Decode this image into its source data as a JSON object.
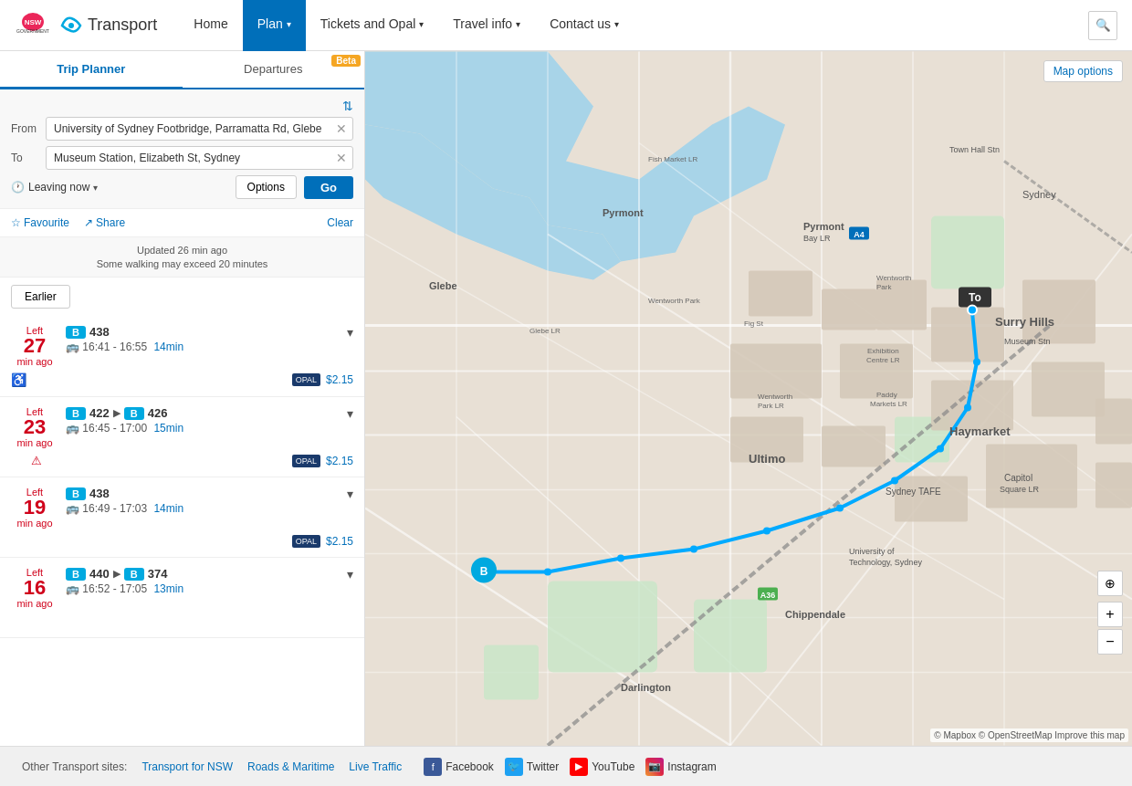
{
  "header": {
    "home_label": "Home",
    "plan_label": "Plan",
    "tickets_label": "Tickets and Opal",
    "travel_label": "Travel info",
    "contact_label": "Contact us",
    "logo_alt": "NSW Transport",
    "logo_transport": "Transport"
  },
  "tabs": {
    "trip_planner": "Trip Planner",
    "departures": "Departures",
    "beta": "Beta"
  },
  "form": {
    "from_label": "From",
    "from_value": "University of Sydney Footbridge, Parramatta Rd, Glebe",
    "to_label": "To",
    "to_value": "Museum Station, Elizabeth St, Sydney",
    "leaving_now": "Leaving now",
    "options_label": "Options",
    "go_label": "Go"
  },
  "actions": {
    "favourite": "Favourite",
    "share": "Share",
    "clear": "Clear"
  },
  "info": {
    "updated": "Updated 26 min ago",
    "walking_note": "Some walking may exceed 20 minutes"
  },
  "earlier_btn": "Earlier",
  "trips": [
    {
      "left_label": "Left",
      "minutes": "27",
      "ago": "min ago",
      "bus_badge": "B",
      "route": "438",
      "time_range": "16:41 - 16:55",
      "duration": "14min",
      "has_accessibility": true,
      "has_warning": false,
      "price": "$2.15"
    },
    {
      "left_label": "Left",
      "minutes": "23",
      "ago": "min ago",
      "bus_badge": "B",
      "route": "422",
      "route2_badge": "B",
      "route2": "426",
      "time_range": "16:45 - 17:00",
      "duration": "15min",
      "has_accessibility": false,
      "has_warning": true,
      "price": "$2.15"
    },
    {
      "left_label": "Left",
      "minutes": "19",
      "ago": "min ago",
      "bus_badge": "B",
      "route": "438",
      "time_range": "16:49 - 17:03",
      "duration": "14min",
      "has_accessibility": false,
      "has_warning": false,
      "price": "$2.15"
    },
    {
      "left_label": "Left",
      "minutes": "16",
      "ago": "min ago",
      "bus_badge": "B",
      "route": "440",
      "route2_badge": "B",
      "route2": "374",
      "time_range": "16:52 - 17:05",
      "duration": "13min",
      "has_accessibility": false,
      "has_warning": false,
      "price": null
    }
  ],
  "map": {
    "options_label": "Map options",
    "attribution": "© Mapbox © OpenStreetMap  Improve this map"
  },
  "footer": {
    "other_sites_label": "Other Transport sites:",
    "transport_nsw": "Transport for NSW",
    "roads": "Roads & Maritime",
    "live_traffic": "Live Traffic",
    "facebook": "Facebook",
    "twitter": "Twitter",
    "youtube": "YouTube",
    "instagram": "Instagram"
  },
  "map_to_label": "To"
}
